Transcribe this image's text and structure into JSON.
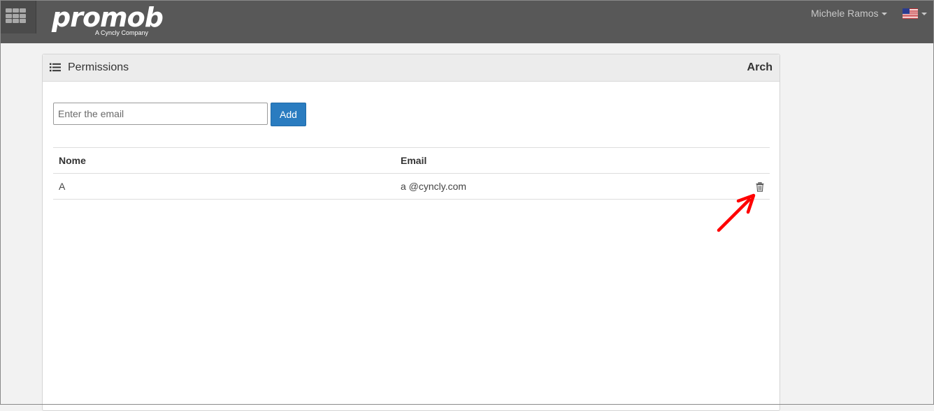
{
  "header": {
    "logo_text": "promob",
    "logo_tagline": "A Cyncly Company",
    "user_name": "Michele Ramos",
    "language_flag": "us-flag-icon"
  },
  "panel": {
    "title": "Permissions",
    "right_label": "Arch",
    "email_placeholder": "Enter the email",
    "add_label": "Add"
  },
  "table": {
    "columns": [
      "Nome",
      "Email"
    ],
    "rows": [
      {
        "name": "A",
        "email": "a @cyncly.com",
        "action_icon": "trash-icon"
      }
    ]
  },
  "colors": {
    "topbar": "#585858",
    "primary_button": "#2a7cc0",
    "annotation_arrow": "#ff0000"
  }
}
